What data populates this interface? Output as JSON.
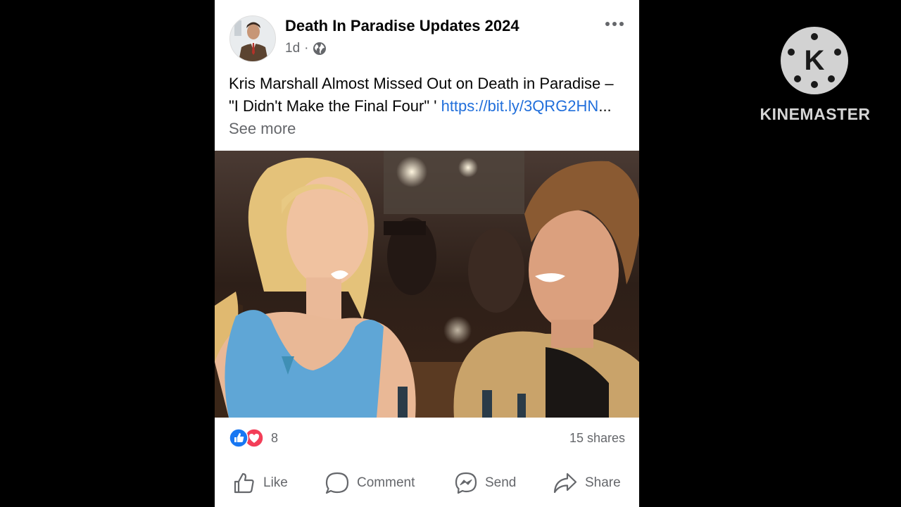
{
  "post": {
    "page_name": "Death In Paradise Updates 2024",
    "time": "1d",
    "separator": "·",
    "caption_text": "Kris Marshall Almost Missed Out on Death in Paradise – \"I Didn't Make the Final Four\" ' ",
    "caption_link": "https://bit.ly/3QRG2HN",
    "caption_ellipsis": "...",
    "see_more": "See more",
    "reaction_icons": [
      "like-icon",
      "love-icon"
    ],
    "reaction_count": "8",
    "shares": "15 shares",
    "actions": {
      "like": "Like",
      "comment": "Comment",
      "send": "Send",
      "share": "Share"
    }
  },
  "watermark": {
    "logo_letter": "K",
    "text": "KINEMASTER"
  },
  "colors": {
    "link": "#216fdb",
    "secondary_text": "#65676b",
    "like_blue": "#1877f2",
    "love_red": "#f33e58",
    "background": "#000000"
  }
}
